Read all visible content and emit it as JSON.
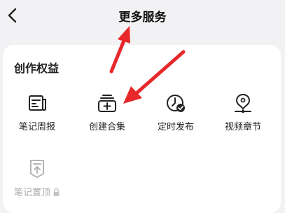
{
  "nav": {
    "title": "更多服务"
  },
  "section": {
    "title": "创作权益"
  },
  "services": [
    {
      "label": "笔记周报",
      "icon": "note-weekly-report-icon"
    },
    {
      "label": "创建合集",
      "icon": "create-collection-icon"
    },
    {
      "label": "定时发布",
      "icon": "scheduled-publish-icon"
    },
    {
      "label": "视频章节",
      "icon": "video-chapters-icon"
    },
    {
      "label": "笔记置顶",
      "icon": "pin-note-icon",
      "locked": true
    }
  ],
  "colors": {
    "accent_arrow": "#e8282b",
    "icon_stroke": "#222222",
    "disabled": "#b5b5b5"
  }
}
